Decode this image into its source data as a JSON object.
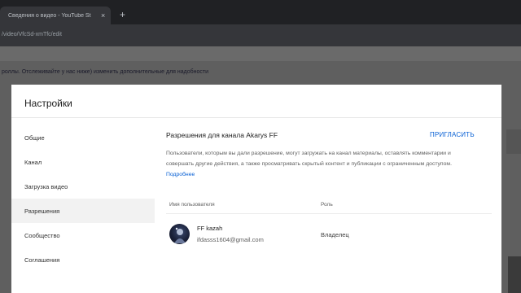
{
  "browser": {
    "tab_title": "Сведения о видео - YouTube St",
    "tab_close": "×",
    "new_tab": "+",
    "address": "/video/VfcSd-xmTfc/edit"
  },
  "page": {
    "banner_text": "роллы. Отслеживайте у нас ниже) изменить дополнительные для надобности"
  },
  "modal": {
    "title": "Настройки",
    "nav": [
      {
        "label": "Общие"
      },
      {
        "label": "Канал"
      },
      {
        "label": "Загрузка видео"
      },
      {
        "label": "Разрешения"
      },
      {
        "label": "Сообщество"
      },
      {
        "label": "Соглашения"
      }
    ],
    "permissions": {
      "title": "Разрешения для канала Akarys FF",
      "invite": "ПРИГЛАСИТЬ",
      "description": "Пользователи, которым вы дали разрешение, могут загружать на канал материалы, оставлять комментарии и совершать другие действия, а также просматривать скрытый контент и публикации с ограниченным доступом.",
      "learn_more": "Подробнее",
      "col_name": "Имя пользователя",
      "col_role": "Роль",
      "users": [
        {
          "name": "FF kazah",
          "email": "ifdasss1604@gmail.com",
          "role": "Владелец"
        }
      ]
    }
  }
}
